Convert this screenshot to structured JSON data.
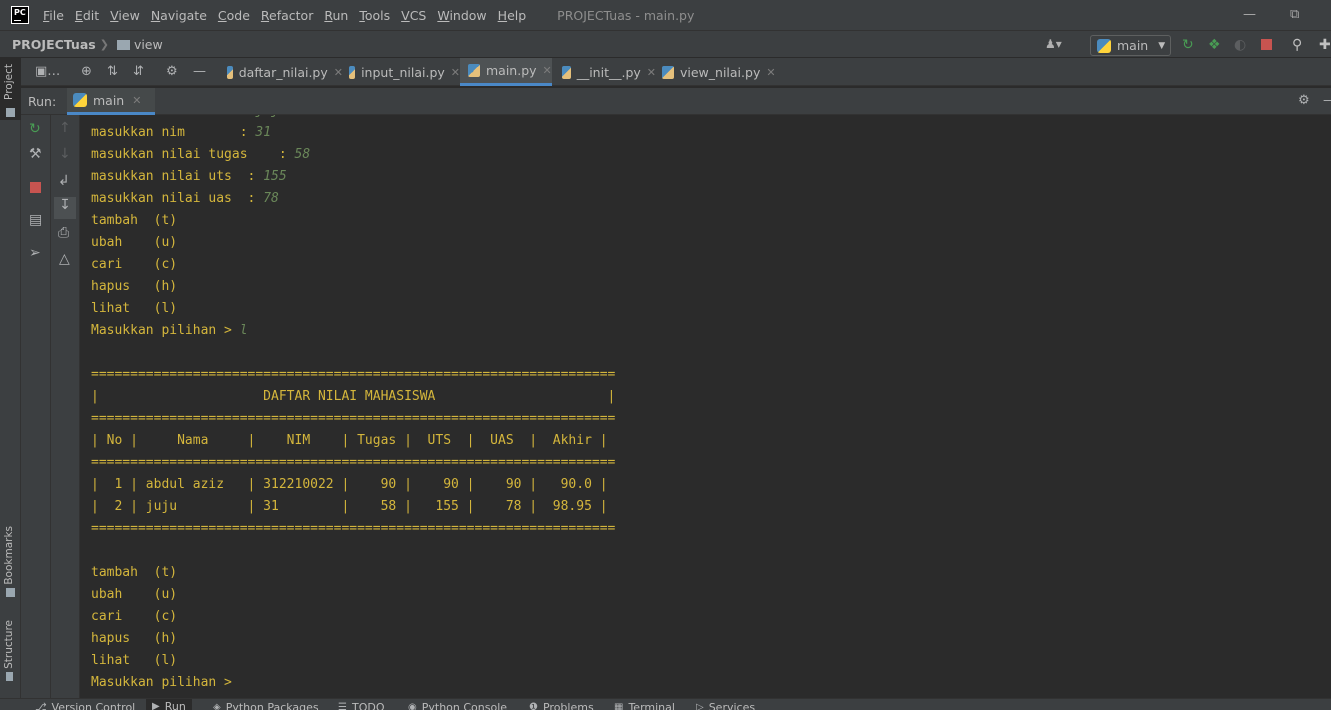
{
  "app": {
    "logo_text": "PC",
    "window_title": "PROJECTuas - main.py"
  },
  "menu": {
    "items": [
      {
        "first": "F",
        "rest": "ile"
      },
      {
        "first": "E",
        "rest": "dit"
      },
      {
        "first": "V",
        "rest": "iew"
      },
      {
        "first": "N",
        "rest": "avigate"
      },
      {
        "first": "C",
        "rest": "ode"
      },
      {
        "first": "R",
        "rest": "efactor"
      },
      {
        "first": "R",
        "rest": "un"
      },
      {
        "first": "T",
        "rest": "ools"
      },
      {
        "first": "V",
        "rest": "CS"
      },
      {
        "first": "W",
        "rest": "indow"
      },
      {
        "first": "H",
        "rest": "elp"
      }
    ]
  },
  "navbar": {
    "project": "PROJECTuas",
    "folder": "view",
    "run_config": "main"
  },
  "side_tabs": {
    "project": "Project",
    "bookmarks": "Bookmarks",
    "structure": "Structure"
  },
  "editor_tabs": [
    {
      "label": "daftar_nilai.py",
      "active": false
    },
    {
      "label": "input_nilai.py",
      "active": false
    },
    {
      "label": "main.py",
      "active": true
    },
    {
      "label": "__init__.py",
      "active": false
    },
    {
      "label": "view_nilai.py",
      "active": false
    }
  ],
  "run_window": {
    "label": "Run:",
    "tab": "main"
  },
  "console": {
    "lines": [
      {
        "prompt": "masukkan nama      : ",
        "input": "juju"
      },
      {
        "prompt": "masukkan nim       : ",
        "input": "31"
      },
      {
        "prompt": "masukkan nilai tugas    : ",
        "input": "58"
      },
      {
        "prompt": "masukkan nilai uts  : ",
        "input": "155"
      },
      {
        "prompt": "masukkan nilai uas  : ",
        "input": "78"
      },
      {
        "prompt": "tambah  (t)",
        "input": ""
      },
      {
        "prompt": "ubah    (u)",
        "input": ""
      },
      {
        "prompt": "cari    (c)",
        "input": ""
      },
      {
        "prompt": "hapus   (h)",
        "input": ""
      },
      {
        "prompt": "lihat   (l)",
        "input": ""
      },
      {
        "prompt": "Masukkan pilihan > ",
        "input": "l"
      },
      {
        "prompt": "",
        "input": ""
      },
      {
        "prompt": "===================================================================",
        "input": ""
      },
      {
        "prompt": "|                     DAFTAR NILAI MAHASISWA                      |",
        "input": ""
      },
      {
        "prompt": "===================================================================",
        "input": ""
      },
      {
        "prompt": "| No |     Nama     |    NIM    | Tugas |  UTS  |  UAS  |  Akhir |",
        "input": ""
      },
      {
        "prompt": "===================================================================",
        "input": ""
      },
      {
        "prompt": "|  1 | abdul aziz   | 312210022 |    90 |    90 |    90 |   90.0 |",
        "input": ""
      },
      {
        "prompt": "|  2 | juju         | 31        |    58 |   155 |    78 |  98.95 |",
        "input": ""
      },
      {
        "prompt": "===================================================================",
        "input": ""
      },
      {
        "prompt": "",
        "input": ""
      },
      {
        "prompt": "tambah  (t)",
        "input": ""
      },
      {
        "prompt": "ubah    (u)",
        "input": ""
      },
      {
        "prompt": "cari    (c)",
        "input": ""
      },
      {
        "prompt": "hapus   (h)",
        "input": ""
      },
      {
        "prompt": "lihat   (l)",
        "input": ""
      },
      {
        "prompt": "Masukkan pilihan > ",
        "input": ""
      }
    ]
  },
  "bottom_tabs": [
    {
      "label": "Version Control",
      "active": false
    },
    {
      "label": "Run",
      "active": true
    },
    {
      "label": "Python Packages",
      "active": false
    },
    {
      "label": "TODO",
      "active": false
    },
    {
      "label": "Python Console",
      "active": false
    },
    {
      "label": "Problems",
      "active": false
    },
    {
      "label": "Terminal",
      "active": false
    },
    {
      "label": "Services",
      "active": false
    }
  ],
  "colors": {
    "console_text": "#d4b63c",
    "user_input": "#6a8759",
    "accent": "#4a88c7",
    "stop": "#c75450",
    "run_green": "#499c54"
  }
}
